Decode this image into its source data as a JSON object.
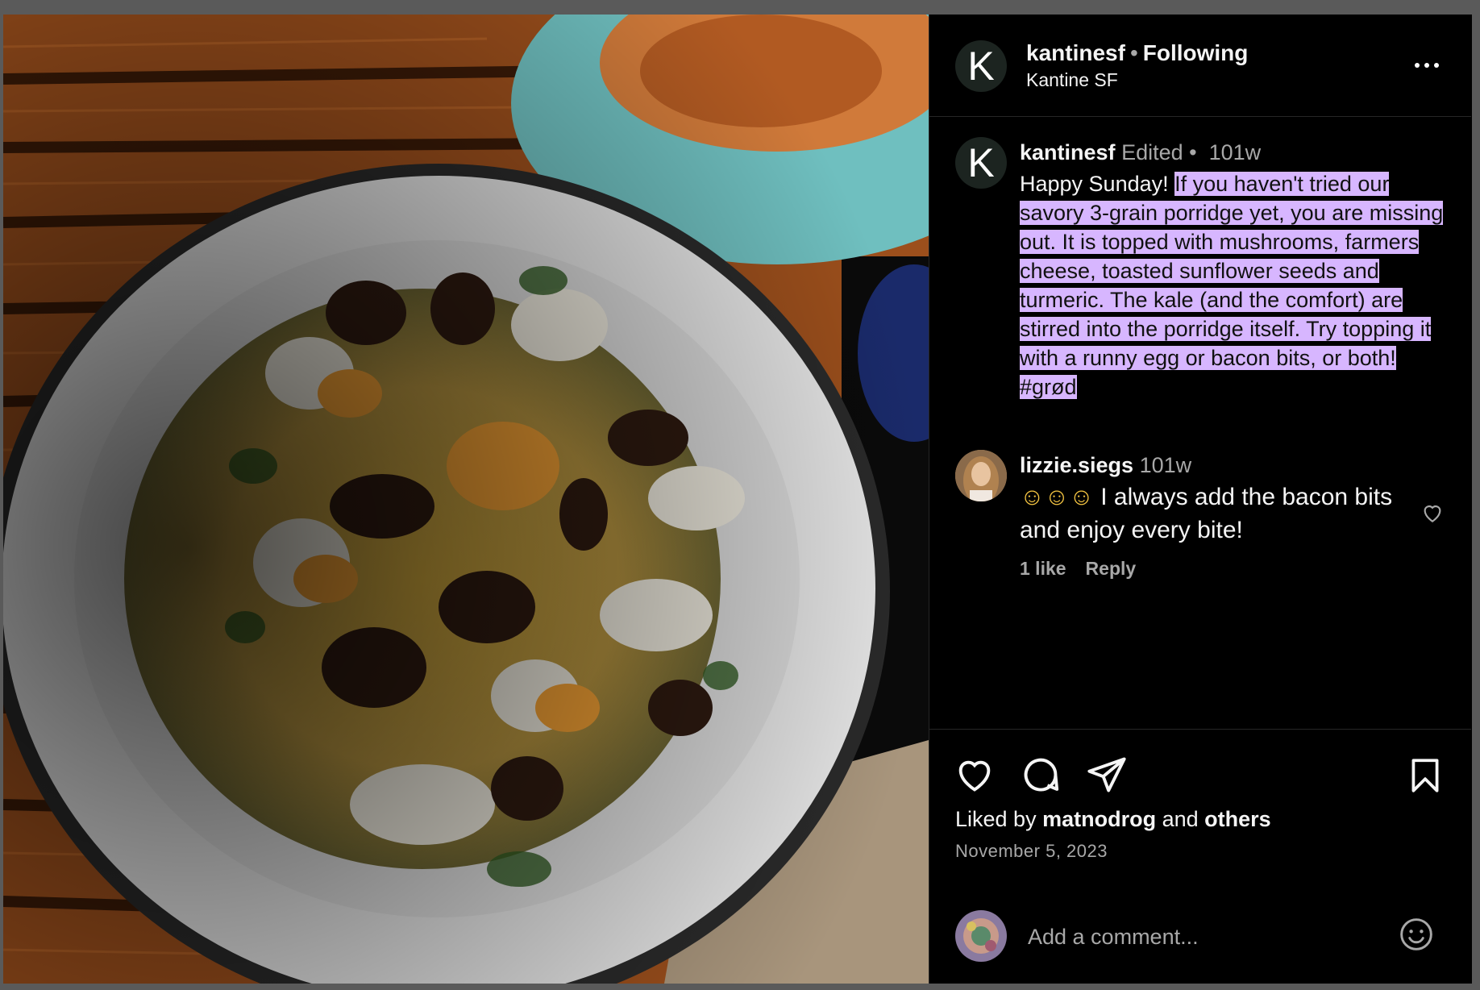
{
  "post": {
    "username": "kantinesf",
    "separator": "•",
    "follow_status": "Following",
    "location": "Kantine SF",
    "avatar_letter": "K",
    "photo_alt": "Savory 3-grain porridge with mushrooms, farmers cheese, sunflower seeds and turmeric"
  },
  "caption": {
    "username": "kantinesf",
    "edited": "Edited",
    "separator": "•",
    "age": "101w",
    "text_plain": "Happy Sunday! ",
    "text_highlighted": "If you haven't tried our savory 3-grain porridge yet, you are missing out. It is topped with mushrooms, farmers cheese, toasted sunflower seeds and turmeric. The kale (and the comfort) are stirred into the porridge itself. Try topping it with a runny egg or bacon bits, or both! #grød"
  },
  "comment": {
    "username": "lizzie.siegs",
    "age": "101w",
    "emojis": "☺☺☺",
    "text": " I always add the bacon bits and enjoy every bite!",
    "likes": "1 like",
    "reply_label": "Reply",
    "like_icon": "heart-outline-icon"
  },
  "footer": {
    "liked_prefix": "Liked by ",
    "liked_user": "matnodrog",
    "liked_mid": " and ",
    "liked_others": "others",
    "date": "November 5, 2023",
    "add_comment_placeholder": "Add a comment...",
    "icons": [
      "heart-icon",
      "comment-icon",
      "share-icon",
      "bookmark-icon",
      "emoji-icon"
    ]
  },
  "colors": {
    "panel_bg": "#000000",
    "highlight": "#d7b6ff",
    "muted_text": "#a8a8a8",
    "divider": "#262626"
  }
}
